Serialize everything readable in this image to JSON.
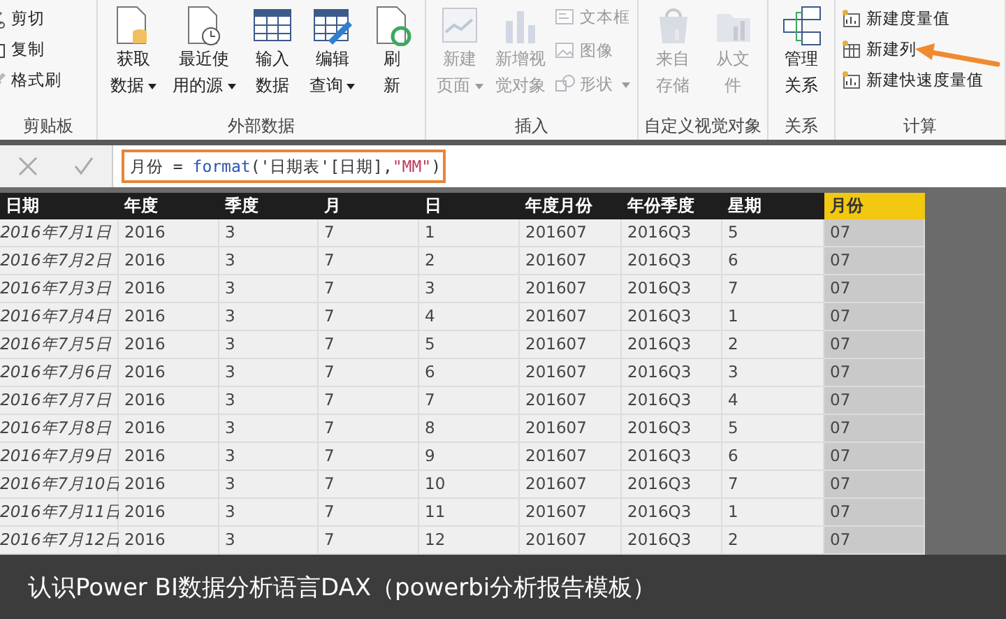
{
  "ribbon": {
    "groups": [
      {
        "label": "剪贴板",
        "items": [
          {
            "kind": "small",
            "label": "剪切",
            "disabled": false
          },
          {
            "kind": "small",
            "label": "复制",
            "disabled": false
          },
          {
            "kind": "small",
            "label": "格式刷",
            "disabled": false
          }
        ]
      },
      {
        "label": "外部数据",
        "items": [
          {
            "kind": "large",
            "label": "获取数据",
            "dropdown": true,
            "disabled": false
          },
          {
            "kind": "large",
            "label": "最近使用的源",
            "dropdown": true,
            "disabled": false
          },
          {
            "kind": "large",
            "label": "输入数据",
            "dropdown": false,
            "disabled": false
          },
          {
            "kind": "large",
            "label": "编辑查询",
            "dropdown": true,
            "disabled": false
          },
          {
            "kind": "large",
            "label": "刷新",
            "dropdown": false,
            "disabled": false
          }
        ]
      },
      {
        "label": "插入",
        "items": [
          {
            "kind": "large",
            "label": "新建页面",
            "dropdown": true,
            "disabled": true
          },
          {
            "kind": "large",
            "label": "新增视觉对象",
            "dropdown": false,
            "disabled": true
          },
          {
            "kind": "small",
            "label": "文本框",
            "disabled": true
          },
          {
            "kind": "small",
            "label": "图像",
            "disabled": true
          },
          {
            "kind": "small",
            "label": "形状",
            "dropdown": true,
            "disabled": true
          }
        ]
      },
      {
        "label": "自定义视觉对象",
        "items": [
          {
            "kind": "large",
            "label": "来自存储",
            "dropdown": false,
            "disabled": true
          },
          {
            "kind": "large",
            "label": "从文件",
            "dropdown": false,
            "disabled": true
          }
        ]
      },
      {
        "label": "关系",
        "items": [
          {
            "kind": "large",
            "label": "管理关系",
            "dropdown": false,
            "disabled": false
          }
        ]
      },
      {
        "label": "计算",
        "items": [
          {
            "kind": "small",
            "label": "新建度量值",
            "disabled": false
          },
          {
            "kind": "small",
            "label": "新建列",
            "disabled": false
          },
          {
            "kind": "small",
            "label": "新建快速度量值",
            "disabled": false
          }
        ]
      }
    ]
  },
  "formula_bar": {
    "tokens": [
      {
        "kind": "plain",
        "text": "月份 = "
      },
      {
        "kind": "function",
        "text": "format"
      },
      {
        "kind": "plain",
        "text": "('日期表'[日期],"
      },
      {
        "kind": "string",
        "text": "\"MM\""
      },
      {
        "kind": "plain",
        "text": ")"
      }
    ]
  },
  "table": {
    "columns": [
      {
        "label": "日期",
        "selected": false
      },
      {
        "label": "年度",
        "selected": false
      },
      {
        "label": "季度",
        "selected": false
      },
      {
        "label": "月",
        "selected": false
      },
      {
        "label": "日",
        "selected": false
      },
      {
        "label": "年度月份",
        "selected": false
      },
      {
        "label": "年份季度",
        "selected": false
      },
      {
        "label": "星期",
        "selected": false
      },
      {
        "label": "月份",
        "selected": true
      }
    ],
    "rows": [
      [
        "2016年7月1日",
        "2016",
        "3",
        "7",
        "1",
        "201607",
        "2016Q3",
        "5",
        "07"
      ],
      [
        "2016年7月2日",
        "2016",
        "3",
        "7",
        "2",
        "201607",
        "2016Q3",
        "6",
        "07"
      ],
      [
        "2016年7月3日",
        "2016",
        "3",
        "7",
        "3",
        "201607",
        "2016Q3",
        "7",
        "07"
      ],
      [
        "2016年7月4日",
        "2016",
        "3",
        "7",
        "4",
        "201607",
        "2016Q3",
        "1",
        "07"
      ],
      [
        "2016年7月5日",
        "2016",
        "3",
        "7",
        "5",
        "201607",
        "2016Q3",
        "2",
        "07"
      ],
      [
        "2016年7月6日",
        "2016",
        "3",
        "7",
        "6",
        "201607",
        "2016Q3",
        "3",
        "07"
      ],
      [
        "2016年7月7日",
        "2016",
        "3",
        "7",
        "7",
        "201607",
        "2016Q3",
        "4",
        "07"
      ],
      [
        "2016年7月8日",
        "2016",
        "3",
        "7",
        "8",
        "201607",
        "2016Q3",
        "5",
        "07"
      ],
      [
        "2016年7月9日",
        "2016",
        "3",
        "7",
        "9",
        "201607",
        "2016Q3",
        "6",
        "07"
      ],
      [
        "2016年7月10日",
        "2016",
        "3",
        "7",
        "10",
        "201607",
        "2016Q3",
        "7",
        "07"
      ],
      [
        "2016年7月11日",
        "2016",
        "3",
        "7",
        "11",
        "201607",
        "2016Q3",
        "1",
        "07"
      ],
      [
        "2016年7月12日",
        "2016",
        "3",
        "7",
        "12",
        "201607",
        "2016Q3",
        "2",
        "07"
      ]
    ]
  },
  "caption": "认识Power BI数据分析语言DAX（powerbi分析报告模板）"
}
